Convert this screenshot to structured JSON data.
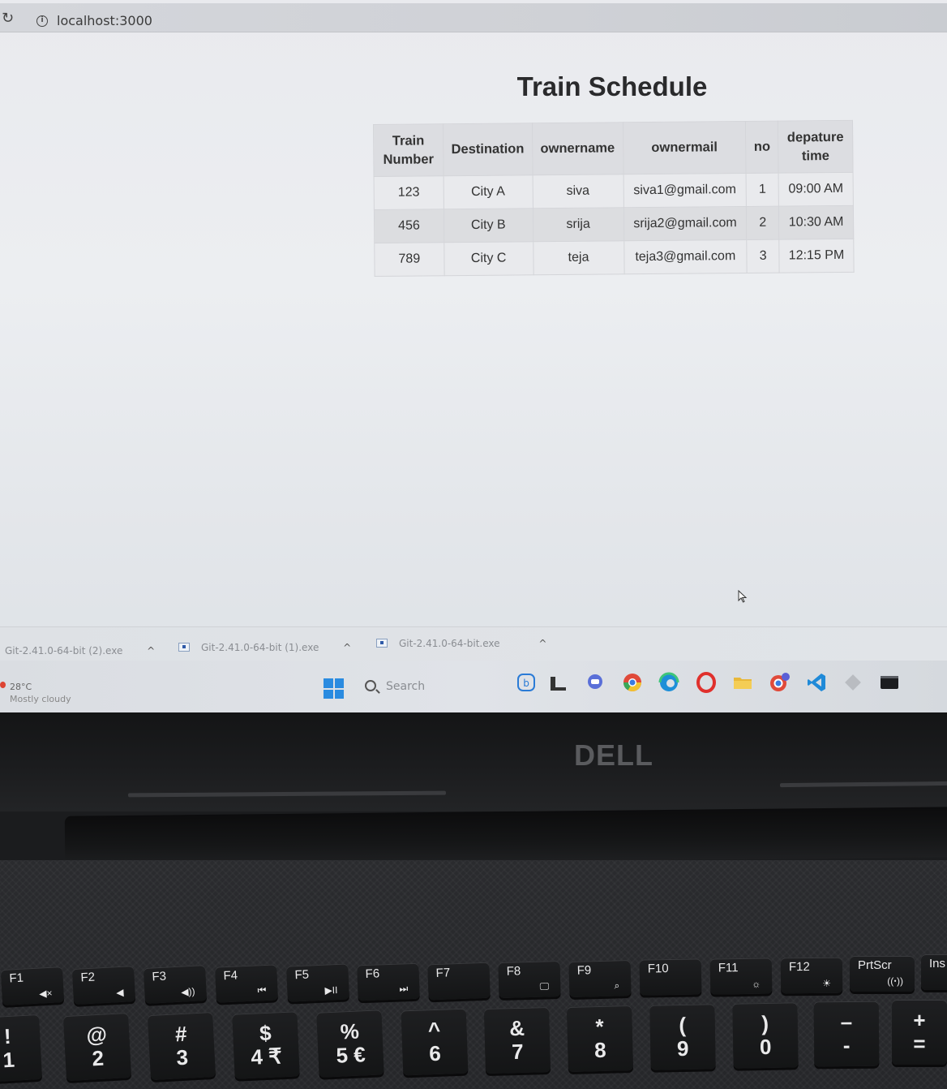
{
  "browser": {
    "url": "localhost:3000"
  },
  "page": {
    "title": "Train Schedule"
  },
  "table": {
    "headers": [
      "Train Number",
      "Destination",
      "ownername",
      "ownermail",
      "no",
      "depature time"
    ],
    "rows": [
      [
        "123",
        "City A",
        "siva",
        "siva1@gmail.com",
        "1",
        "09:00 AM"
      ],
      [
        "456",
        "City B",
        "srija",
        "srija2@gmail.com",
        "2",
        "10:30 AM"
      ],
      [
        "789",
        "City C",
        "teja",
        "teja3@gmail.com",
        "3",
        "12:15 PM"
      ]
    ]
  },
  "downloads": [
    {
      "name": "Git-2.41.0-64-bit (2).exe"
    },
    {
      "name": "Git-2.41.0-64-bit (1).exe"
    },
    {
      "name": "Git-2.41.0-64-bit.exe"
    }
  ],
  "taskbar": {
    "weather_temp": "28°C",
    "weather_desc": "Mostly cloudy",
    "search_label": "Search",
    "icons": [
      "bing-icon",
      "file-explorer-icon",
      "teams-chat-icon",
      "chrome-icon",
      "edge-icon",
      "opera-icon",
      "folder-icon",
      "chrome-profile-icon",
      "vscode-icon",
      "git-icon",
      "terminal-icon"
    ]
  },
  "laptop": {
    "brand": "DELL"
  },
  "keyboard": {
    "fkeys": [
      {
        "label": "F1",
        "sym": "◀×"
      },
      {
        "label": "F2",
        "sym": "◀"
      },
      {
        "label": "F3",
        "sym": "◀))"
      },
      {
        "label": "F4",
        "sym": "⏮"
      },
      {
        "label": "F5",
        "sym": "▶II"
      },
      {
        "label": "F6",
        "sym": "⏭"
      },
      {
        "label": "F7",
        "sym": ""
      },
      {
        "label": "F8",
        "sym": "🖵"
      },
      {
        "label": "F9",
        "sym": "⌕"
      },
      {
        "label": "F10",
        "sym": ""
      },
      {
        "label": "F11",
        "sym": "☼"
      },
      {
        "label": "F12",
        "sym": "☀"
      },
      {
        "label": "PrtScr",
        "sym": "((ꞏ))"
      },
      {
        "label": "Ins",
        "sym": ""
      }
    ],
    "numkeys": [
      {
        "top": "!",
        "bot": "1"
      },
      {
        "top": "@",
        "bot": "2"
      },
      {
        "top": "#",
        "bot": "3"
      },
      {
        "top": "$",
        "bot": "4 ₹"
      },
      {
        "top": "%",
        "bot": "5 €"
      },
      {
        "top": "^",
        "bot": "6"
      },
      {
        "top": "&",
        "bot": "7"
      },
      {
        "top": "*",
        "bot": "8"
      },
      {
        "top": "(",
        "bot": "9"
      },
      {
        "top": ")",
        "bot": "0"
      },
      {
        "top": "–",
        "bot": "-"
      },
      {
        "top": "+",
        "bot": "="
      }
    ]
  }
}
